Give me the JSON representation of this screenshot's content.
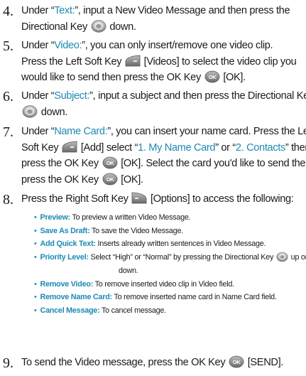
{
  "steps": [
    {
      "num": "4.",
      "lines": [
        {
          "a": "Under “",
          "h": "Text:",
          "b": "”, input a New Video Message and then press the"
        },
        {
          "a": "Directional Key",
          "b": "down."
        }
      ]
    },
    {
      "num": "5.",
      "lines": [
        {
          "a": "Under “",
          "h": "Video:",
          "b": "”, you can only insert/remove one video clip."
        },
        {
          "a": "Press the Left Soft Key",
          "b": "[Videos] to select the video clip you"
        },
        {
          "a": "would like to send then press the OK Key",
          "b": "[OK]."
        }
      ]
    },
    {
      "num": "6.",
      "lines": [
        {
          "a": "Under “",
          "h": "Subject:",
          "b": "”, input a subject and then press the Directional Key"
        },
        {
          "b": "down."
        }
      ]
    },
    {
      "num": "7.",
      "lines": [
        {
          "a": "Under “",
          "h": "Name Card:",
          "b": "”, you can insert your name card. Press the Left"
        },
        {
          "a": "Soft Key",
          "b": "[Add] select “",
          "h2": "1. My Name Card",
          "c": "” or “",
          "h3": "2. Contacts",
          "d": "” then"
        },
        {
          "a": "press the OK Key",
          "b": "[OK]. Select the card you'd like to send then"
        },
        {
          "a": "press the OK Key",
          "b": "[OK]."
        }
      ]
    },
    {
      "num": "8.",
      "lines": [
        {
          "a": "Press the Right Soft Key",
          "b": "[Options] to access the following:"
        }
      ]
    },
    {
      "num": "9.",
      "lines": [
        {
          "a": "To send the Video message, press the OK Key",
          "b": "[SEND]."
        }
      ]
    }
  ],
  "options": [
    {
      "term": "Preview:",
      "desc": "To preview a written Video Message."
    },
    {
      "term": "Save As Draft:",
      "desc": "To save the Video Message."
    },
    {
      "term": "Add Quick Text:",
      "desc": "Inserts already written sentences in Video Message."
    },
    {
      "term": "Priority Level:",
      "desc": "Select “High” or “Normal” by pressing the Directional Key",
      "desc_b": "up or",
      "desc_cont": "down."
    },
    {
      "term": "Remove Video:",
      "desc": "To remove inserted video clip in Video field."
    },
    {
      "term": "Remove Name Card:",
      "desc": "To remove inserted name card in Name Card field."
    },
    {
      "term": "Cancel Message:",
      "desc": "To cancel message."
    }
  ],
  "icons": {
    "directional": "directional-key-icon",
    "left_soft": "left-soft-key-icon",
    "right_soft": "right-soft-key-icon",
    "ok": "ok-key-icon",
    "ok_label": "OK"
  },
  "colors": {
    "accent": "#1d8ab3",
    "text": "#1a1a1a"
  }
}
